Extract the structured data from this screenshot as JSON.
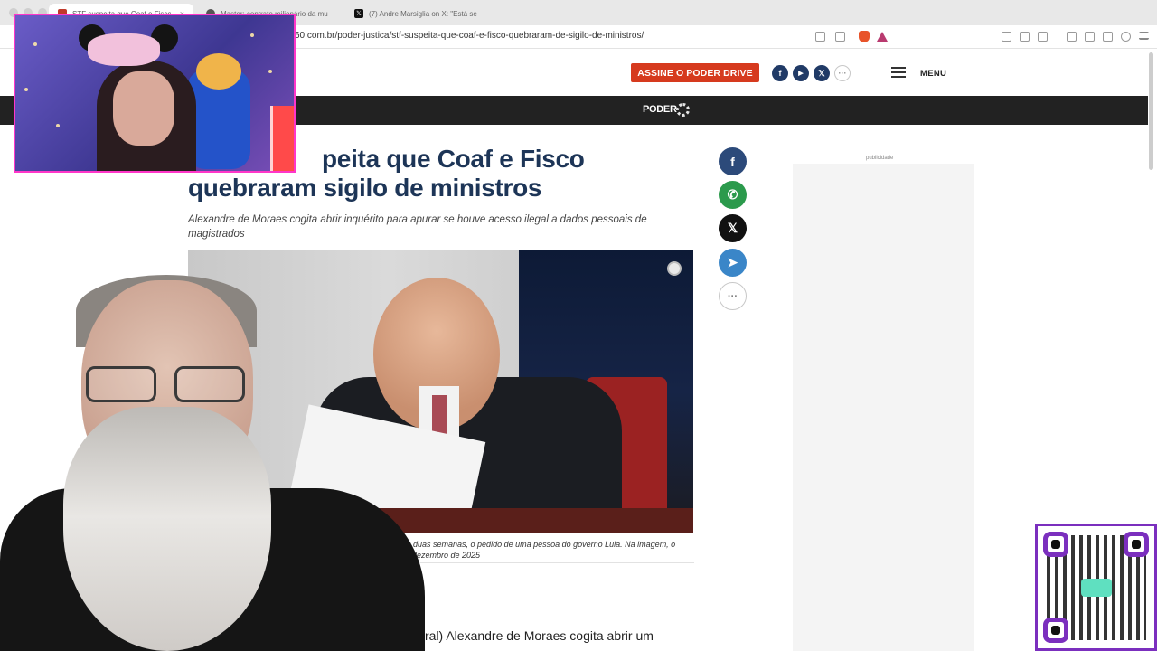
{
  "browser": {
    "tabs": [
      {
        "label": "STF suspeita que Coaf e Fisco",
        "active": true
      },
      {
        "label": "Master: contrato milionário da mu",
        "active": false
      },
      {
        "label": "(7) Andre Marsiglia on X: \"Está se",
        "active": false
      }
    ],
    "tab_close_glyph": "×",
    "url": "60.com.br/poder-justica/stf-suspeita-que-coaf-e-fisco-quebraram-de-sigilo-de-ministros/"
  },
  "site": {
    "subscribe_label": "ASSINE O PODER DRIVE",
    "menu_label": "MENU",
    "logo_text": "PODER",
    "header_social": [
      "f",
      "▶",
      "𝕏",
      "···"
    ],
    "colors": {
      "subscribe": "#d63a1e",
      "brand_bar": "#222222",
      "headline": "#1d3557"
    }
  },
  "article": {
    "headline_line1": "peita que Coaf e Fisco",
    "headline_line2": "quebraram sigilo de ministros",
    "subhead": "Alexandre de Moraes cogita abrir inquérito para apurar se houve acesso ilegal a dados pessoais de magistrados",
    "caption_line1": "últimas duas semanas, o pedido de uma pessoa do governo Lula. Na imagem, o",
    "caption_line2": "ma em dezembro de 2025",
    "body_fragment": "ral) Alexandre de Moraes cogita abrir um"
  },
  "share": {
    "facebook": "f",
    "whatsapp": "✆",
    "x": "𝕏",
    "telegram": "➤",
    "more": "···"
  },
  "ad": {
    "label": "publicidade"
  }
}
